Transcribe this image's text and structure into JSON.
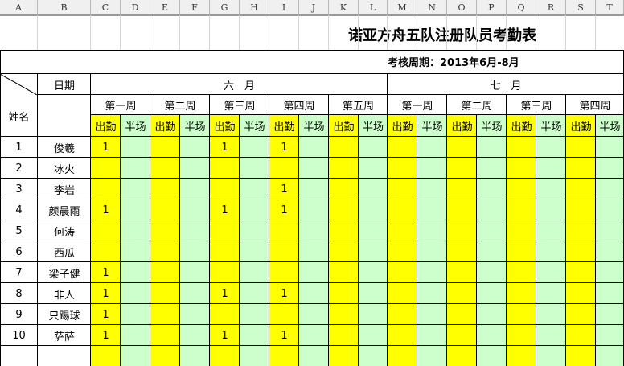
{
  "columns": [
    "A",
    "B",
    "C",
    "D",
    "E",
    "F",
    "G",
    "H",
    "I",
    "J",
    "K",
    "L",
    "M",
    "N",
    "O",
    "P",
    "Q",
    "R",
    "S",
    "T"
  ],
  "title": "诺亚方舟五队注册队员考勤表",
  "period": "考核周期：2013年6月-8月",
  "header": {
    "date_label": "日期",
    "name_label": "姓名",
    "months": [
      "六　月",
      "七　月"
    ],
    "weeks": [
      "第一周",
      "第二周",
      "第三周",
      "第四周",
      "第五周",
      "第一周",
      "第二周",
      "第三周",
      "第四周"
    ],
    "sub": [
      "出勤",
      "半场"
    ]
  },
  "rows": [
    {
      "no": "1",
      "name": "俊羲",
      "attend": [
        "1",
        "",
        "1",
        "1",
        "",
        "",
        "",
        "",
        ""
      ]
    },
    {
      "no": "2",
      "name": "冰火",
      "attend": [
        "",
        "",
        "",
        "",
        "",
        "",
        "",
        "",
        ""
      ]
    },
    {
      "no": "3",
      "name": "李岩",
      "attend": [
        "",
        "",
        "",
        "1",
        "",
        "",
        "",
        "",
        ""
      ]
    },
    {
      "no": "4",
      "name": "颜晨雨",
      "attend": [
        "1",
        "",
        "1",
        "1",
        "",
        "",
        "",
        "",
        ""
      ]
    },
    {
      "no": "5",
      "name": "何涛",
      "attend": [
        "",
        "",
        "",
        "",
        "",
        "",
        "",
        "",
        ""
      ]
    },
    {
      "no": "6",
      "name": "西瓜",
      "attend": [
        "",
        "",
        "",
        "",
        "",
        "",
        "",
        "",
        ""
      ]
    },
    {
      "no": "7",
      "name": "梁子健",
      "attend": [
        "1",
        "",
        "",
        "",
        "",
        "",
        "",
        "",
        ""
      ]
    },
    {
      "no": "8",
      "name": "非人",
      "attend": [
        "1",
        "",
        "1",
        "1",
        "",
        "",
        "",
        "",
        ""
      ]
    },
    {
      "no": "9",
      "name": "只踢球",
      "attend": [
        "1",
        "",
        "",
        "",
        "",
        "",
        "",
        "",
        ""
      ]
    },
    {
      "no": "10",
      "name": "萨萨",
      "attend": [
        "1",
        "",
        "1",
        "1",
        "",
        "",
        "",
        "",
        ""
      ]
    }
  ],
  "colors": {
    "attend": "#ffff00",
    "half": "#ccffcc",
    "header_bg": "#f0f0f0"
  }
}
